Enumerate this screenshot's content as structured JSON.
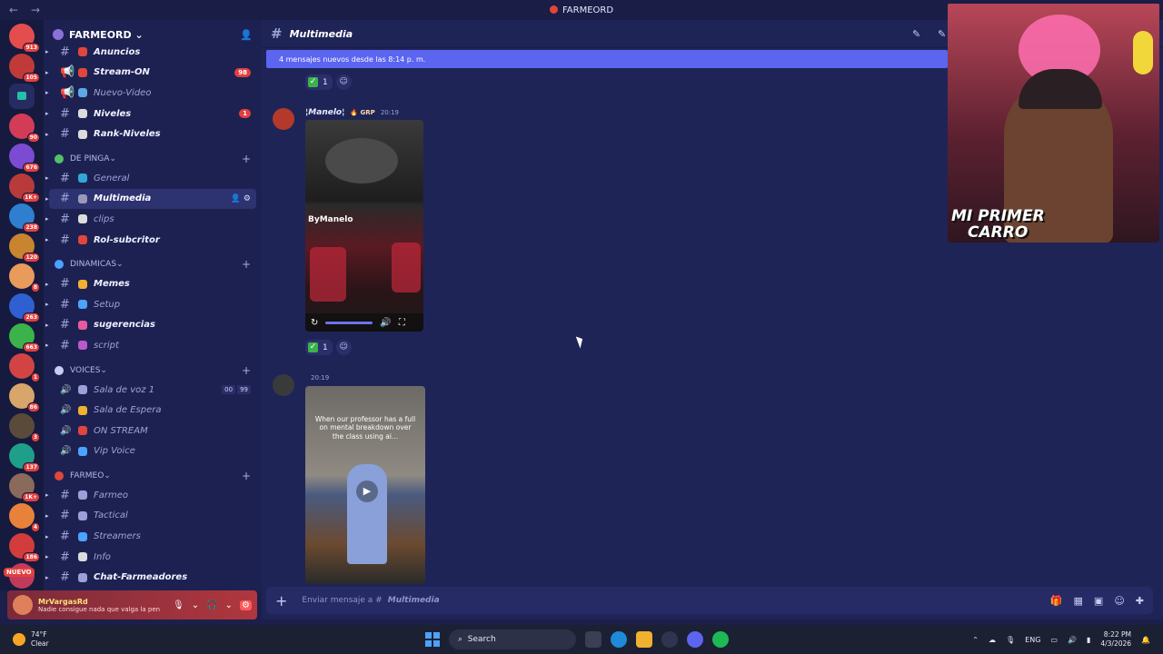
{
  "window": {
    "title": "FARMEORD"
  },
  "server": {
    "name": "FARMEORD",
    "nuevo_label": "NUEVO"
  },
  "rail": [
    {
      "badge": "913",
      "color": "#e44d4d"
    },
    {
      "badge": "105",
      "color": "#c03a3a"
    },
    {
      "badge": "",
      "color": "folder"
    },
    {
      "badge": "90",
      "color": "#d23c57"
    },
    {
      "badge": "676",
      "color": "#7b4bd1"
    },
    {
      "badge": "1K+",
      "color": "#b83a3a"
    },
    {
      "badge": "238",
      "color": "#2f7fd1"
    },
    {
      "badge": "120",
      "color": "#c9842f"
    },
    {
      "badge": "8",
      "color": "#e89b5a"
    },
    {
      "badge": "263",
      "color": "#2f5fd1"
    },
    {
      "badge": "663",
      "color": "#3bb34a"
    },
    {
      "badge": "1",
      "color": "#d24444"
    },
    {
      "badge": "86",
      "color": "#d8a66a"
    },
    {
      "badge": "3",
      "color": "#5a4a3a"
    },
    {
      "badge": "137",
      "color": "#1f9f8a"
    },
    {
      "badge": "1K+",
      "color": "#8a6a5a"
    },
    {
      "badge": "4",
      "color": "#e8823a"
    },
    {
      "badge": "186",
      "color": "#d23c3c"
    },
    {
      "badge": "",
      "color": "#c23a5a"
    }
  ],
  "sidebar": {
    "top_channels": [
      {
        "name": "Anuncios",
        "bold": true,
        "icon": "#e0463b"
      },
      {
        "name": "Stream-ON",
        "bold": true,
        "icon": "#e0463b",
        "pill": "98",
        "speaker": true
      },
      {
        "name": "Nuevo-Video",
        "bold": false,
        "icon": "#5fa8e8",
        "speaker": true
      },
      {
        "name": "Niveles",
        "bold": true,
        "icon": "#dcdcdc",
        "pill": "1"
      },
      {
        "name": "Rank-Niveles",
        "bold": true,
        "icon": "#dcdcdc"
      }
    ],
    "categories": [
      {
        "name": "DE PINGA",
        "icon": "#55c06a",
        "channels": [
          {
            "name": "General",
            "bold": false,
            "icon": "#2fa8d8"
          },
          {
            "name": "Multimedia",
            "bold": true,
            "icon": "#9a9ab8",
            "active": true
          },
          {
            "name": "clips",
            "bold": false,
            "icon": "#dcdcdc"
          },
          {
            "name": "Rol-subcritor",
            "bold": true,
            "icon": "#e0463b"
          }
        ]
      },
      {
        "name": "DINAMICAS",
        "icon": "#4aa3ff",
        "channels": [
          {
            "name": "Memes",
            "bold": true,
            "icon": "#f0b030"
          },
          {
            "name": "Setup",
            "bold": false,
            "icon": "#4aa3ff"
          },
          {
            "name": "sugerencias",
            "bold": true,
            "icon": "#e85aa0"
          },
          {
            "name": "script",
            "bold": false,
            "icon": "#b85ac8"
          }
        ]
      },
      {
        "name": "VOICES",
        "icon": "#c8ccf5",
        "voice": true,
        "channels": [
          {
            "name": "Sala de voz 1",
            "icon": "#9aa0d8",
            "count": [
              "00",
              "99"
            ]
          },
          {
            "name": "Sala de Espera",
            "icon": "#f0b030"
          },
          {
            "name": "ON STREAM",
            "icon": "#e0463b"
          },
          {
            "name": "Vip Voice",
            "icon": "#4aa3ff"
          }
        ]
      },
      {
        "name": "FARMEO",
        "icon": "#e0463b",
        "channels": [
          {
            "name": "Farmeo",
            "bold": false,
            "icon": "#9aa0d8"
          },
          {
            "name": "Tactical",
            "bold": false,
            "icon": "#9aa0d8"
          },
          {
            "name": "Streamers",
            "bold": false,
            "icon": "#4aa3ff"
          },
          {
            "name": "Info",
            "bold": false,
            "icon": "#dcdcdc"
          },
          {
            "name": "Chat-Farmeadores",
            "bold": true,
            "icon": "#9aa0d8"
          }
        ]
      }
    ]
  },
  "user": {
    "name": "MrVargasRd",
    "status": "Nadie consigue nada que valga la pen"
  },
  "channel": {
    "name": "Multimedia",
    "new_messages_banner": "4 mensajes nuevos desde las 8:14 p. m."
  },
  "messages": [
    {
      "author": "¦Manelo¦",
      "tag": "GRP",
      "time": "20:19",
      "watermark": "ByManelo",
      "reaction_count": "1"
    },
    {
      "author": "",
      "time": "20:19",
      "caption": "When our professor has a full on mental breakdown over the class using ai..."
    }
  ],
  "top_reaction_count": "1",
  "composer": {
    "placeholder": "Enviar mensaje a #",
    "channel": "Multimedia"
  },
  "stream_overlay": {
    "line1": "MI PRIMER",
    "line2": "CARRO"
  },
  "taskbar": {
    "temp": "74°F",
    "weather": "Clear",
    "search": "Search",
    "lang": "ENG",
    "time": "8:22 PM",
    "date": "4/3/2026"
  }
}
